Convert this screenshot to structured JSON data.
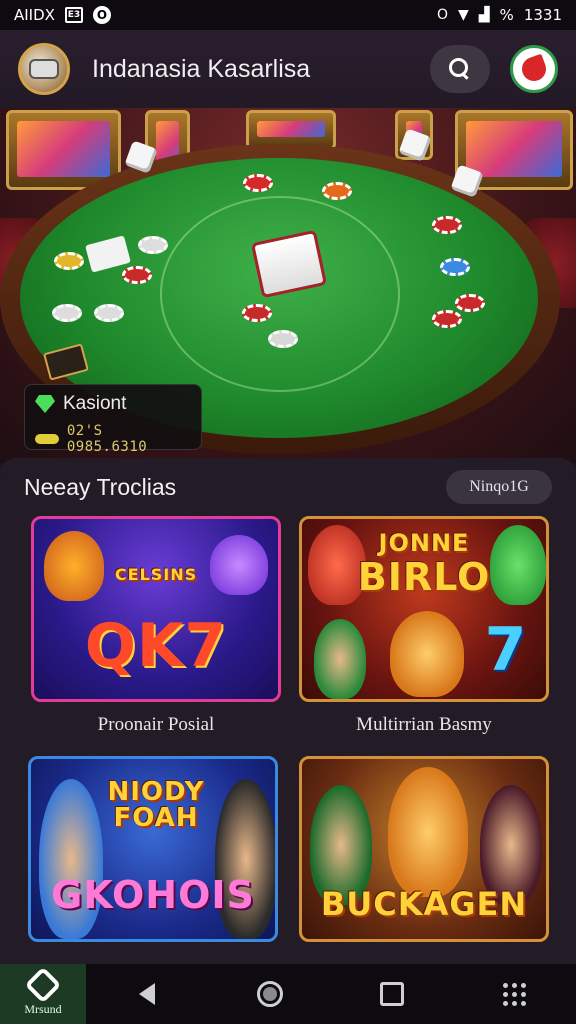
{
  "status_bar": {
    "left_text": "AIIDX",
    "box_text": "E3",
    "circle_text": "O",
    "right_icon": "O",
    "signal": "%",
    "time": "1331"
  },
  "header": {
    "title": "Indanasia Kasarlisa"
  },
  "hero": {
    "balance_label": "Kasiont",
    "balance_value": "02'S 0985.6310"
  },
  "section": {
    "title": "Neeay Troclias",
    "button_label": "Ninqo1G"
  },
  "games": [
    {
      "name": "Proonair Posial",
      "art_top": "CELSINS",
      "art_main": "QK7"
    },
    {
      "name": "Multirrian Basmy",
      "art_top": "JONNE",
      "art_main": "BIRLO",
      "art_num": "7"
    },
    {
      "name": "",
      "art_top": "NIODY FOAH",
      "art_main": "GKOHOIS"
    },
    {
      "name": "",
      "art_top": "",
      "art_main": "BUCKAGEN"
    }
  ],
  "nav": {
    "home_label": "Mrsund"
  },
  "icons": {
    "search": "search-icon",
    "back": "back-icon",
    "home": "home-icon",
    "recents": "recents-icon",
    "apps": "apps-grid-icon"
  },
  "colors": {
    "accent_green": "#2f9a4a",
    "felt": "#1f8a2c",
    "gold": "#ffd23a",
    "background": "#231c27"
  }
}
